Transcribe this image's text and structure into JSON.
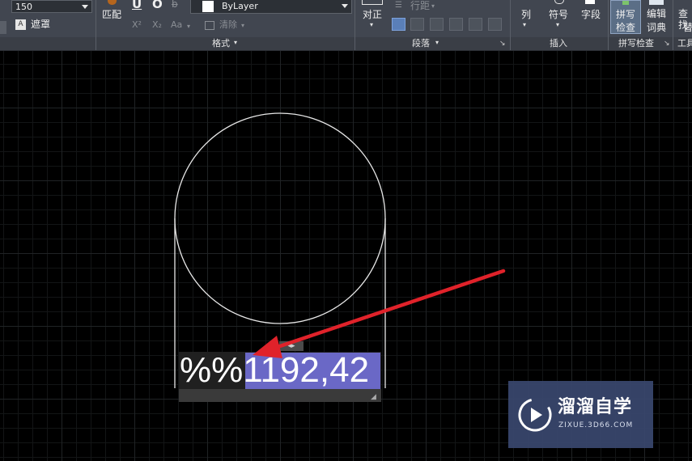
{
  "ribbon": {
    "text_height_value": "150",
    "mask_label": "遮罩",
    "match_label": "匹配",
    "underline_label": "U",
    "overline_label": "O",
    "strikethrough_label": "b̶",
    "superscript_label": "X²",
    "subscript_label": "X₂",
    "case_label": "Aa",
    "layer_value": "ByLayer",
    "clear_label": "清除",
    "format_title": "格式",
    "justify_label": "对正",
    "line_spacing_label": "行距",
    "paragraph_title": "段落",
    "column_label": "列",
    "symbol_label": "符号",
    "field_label": "字段",
    "insert_title": "插入",
    "spellcheck_label_line1": "拼写",
    "spellcheck_label_line2": "检查",
    "edit_dict_line1": "编辑",
    "edit_dict_line2": "词典",
    "spellcheck_title": "拼写检查",
    "find_label_line1": "查找",
    "find_label_line2": "替",
    "tools_title": "工具"
  },
  "drawing": {
    "text_prefix": "%%",
    "text_selected": "1192,42",
    "selection_color": "#6a68c6",
    "arrow_color": "#e0222a"
  },
  "watermark": {
    "title": "溜溜自学",
    "subtitle": "ZIXUE.3D66.COM"
  },
  "colors": {
    "ribbon_bg": "#414650",
    "canvas_bg": "#000000",
    "geometry_stroke": "#e8e8e8"
  }
}
